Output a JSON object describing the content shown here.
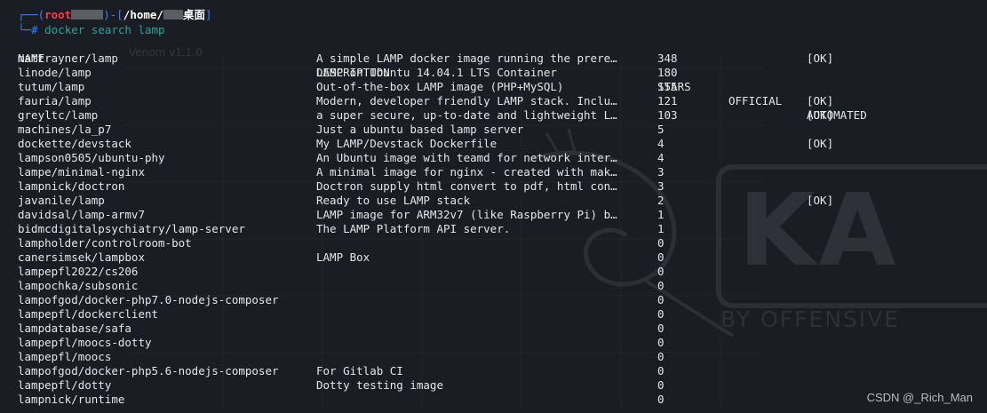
{
  "prompt": {
    "user": "root",
    "path_prefix": "/home/",
    "path_suffix": "桌面",
    "hash": "#",
    "command": "docker search lamp"
  },
  "table": {
    "headers": {
      "name": "NAME",
      "description": "DESCRIPTION",
      "stars": "STARS",
      "official": "OFFICIAL",
      "automated": "AUTOMATED"
    },
    "rows": [
      {
        "name": "mattrayner/lamp",
        "description": "A simple LAMP docker image running the prere…",
        "stars": "348",
        "official": "",
        "automated": "[OK]"
      },
      {
        "name": "linode/lamp",
        "description": "LAMP on Ubuntu 14.04.1 LTS Container",
        "stars": "180",
        "official": "",
        "automated": ""
      },
      {
        "name": "tutum/lamp",
        "description": "Out-of-the-box LAMP image (PHP+MySQL)",
        "stars": "155",
        "official": "",
        "automated": ""
      },
      {
        "name": "fauria/lamp",
        "description": "Modern, developer friendly LAMP stack. Inclu…",
        "stars": "121",
        "official": "",
        "automated": "[OK]"
      },
      {
        "name": "greyltc/lamp",
        "description": "a super secure, up-to-date and lightweight L…",
        "stars": "103",
        "official": "",
        "automated": "[OK]"
      },
      {
        "name": "machines/la_p7",
        "description": "Just a ubuntu based lamp server",
        "stars": "5",
        "official": "",
        "automated": ""
      },
      {
        "name": "dockette/devstack",
        "description": "My LAMP/Devstack Dockerfile",
        "stars": "4",
        "official": "",
        "automated": "[OK]"
      },
      {
        "name": "lampson0505/ubuntu-phy",
        "description": "An Ubuntu image with teamd for network inter…",
        "stars": "4",
        "official": "",
        "automated": ""
      },
      {
        "name": "lampe/minimal-nginx",
        "description": "A minimal image for nginx - created with mak…",
        "stars": "3",
        "official": "",
        "automated": ""
      },
      {
        "name": "lampnick/doctron",
        "description": "Doctron supply html convert to pdf, html con…",
        "stars": "3",
        "official": "",
        "automated": ""
      },
      {
        "name": "javanile/lamp",
        "description": "Ready to use LAMP stack",
        "stars": "2",
        "official": "",
        "automated": "[OK]"
      },
      {
        "name": "davidsal/lamp-armv7",
        "description": "LAMP image for ARM32v7 (like Raspberry Pi) b…",
        "stars": "1",
        "official": "",
        "automated": ""
      },
      {
        "name": "bidmcdigitalpsychiatry/lamp-server",
        "description": "The LAMP Platform API server.",
        "stars": "1",
        "official": "",
        "automated": ""
      },
      {
        "name": "lampholder/controlroom-bot",
        "description": "",
        "stars": "0",
        "official": "",
        "automated": ""
      },
      {
        "name": "canersimsek/lampbox",
        "description": "LAMP Box",
        "stars": "0",
        "official": "",
        "automated": ""
      },
      {
        "name": "lampepfl2022/cs206",
        "description": "",
        "stars": "0",
        "official": "",
        "automated": ""
      },
      {
        "name": "lampochka/subsonic",
        "description": "",
        "stars": "0",
        "official": "",
        "automated": ""
      },
      {
        "name": "lampofgod/docker-php7.0-nodejs-composer",
        "description": "",
        "stars": "0",
        "official": "",
        "automated": ""
      },
      {
        "name": "lampepfl/dockerclient",
        "description": "",
        "stars": "0",
        "official": "",
        "automated": ""
      },
      {
        "name": "lampdatabase/safa",
        "description": "",
        "stars": "0",
        "official": "",
        "automated": ""
      },
      {
        "name": "lampepfl/moocs-dotty",
        "description": "",
        "stars": "0",
        "official": "",
        "automated": ""
      },
      {
        "name": "lampepfl/moocs",
        "description": "",
        "stars": "0",
        "official": "",
        "automated": ""
      },
      {
        "name": "lampofgod/docker-php5.6-nodejs-composer",
        "description": "For Gitlab CI",
        "stars": "0",
        "official": "",
        "automated": ""
      },
      {
        "name": "lampepfl/dotty",
        "description": "Dotty testing image",
        "stars": "0",
        "official": "",
        "automated": ""
      },
      {
        "name": "lampnick/runtime",
        "description": "",
        "stars": "0",
        "official": "",
        "automated": ""
      }
    ]
  },
  "watermark": {
    "brand": "KA",
    "tagline": "BY OFFENSIVE",
    "venom": "Venom v1.1.0"
  },
  "credit": "CSDN @_Rich_Man",
  "colors": {
    "background": "#1b1d24",
    "prompt_bracket": "#3b82f6",
    "prompt_user": "#ff3b3b",
    "command": "#2aa198",
    "text": "#e6e6e6"
  }
}
